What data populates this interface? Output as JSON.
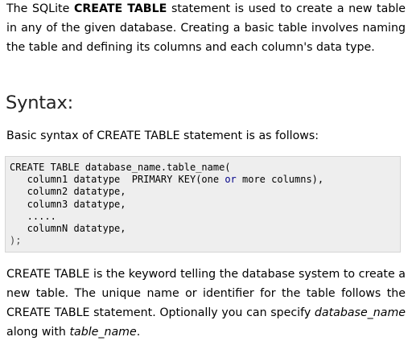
{
  "intro": {
    "text_before": "The SQLite ",
    "bold": "CREATE TABLE",
    "text_after": " statement is used to create a new table in any of the given database. Creating a basic table involves naming the table and defining its columns and each column's data type."
  },
  "syntax": {
    "heading": "Syntax:",
    "description": "Basic syntax of CREATE TABLE statement is as follows:"
  },
  "code": {
    "line1": "CREATE TABLE database_name.table_name(",
    "line2_pre": "   column1 datatype  PRIMARY KEY(one ",
    "line2_kw": "or",
    "line2_post": " more columns),",
    "line3": "   column2 datatype,",
    "line4": "   column3 datatype,",
    "line5": "   .....",
    "line6": "   columnN datatype,",
    "line7": ");"
  },
  "outro": {
    "text1": "CREATE TABLE is the keyword telling the database system to create a new table. The unique name or identifier for the table follows the CREATE TABLE statement. Optionally you can specify ",
    "em1": "database_name",
    "text2": " along with ",
    "em2": "table_name",
    "text3": "."
  }
}
